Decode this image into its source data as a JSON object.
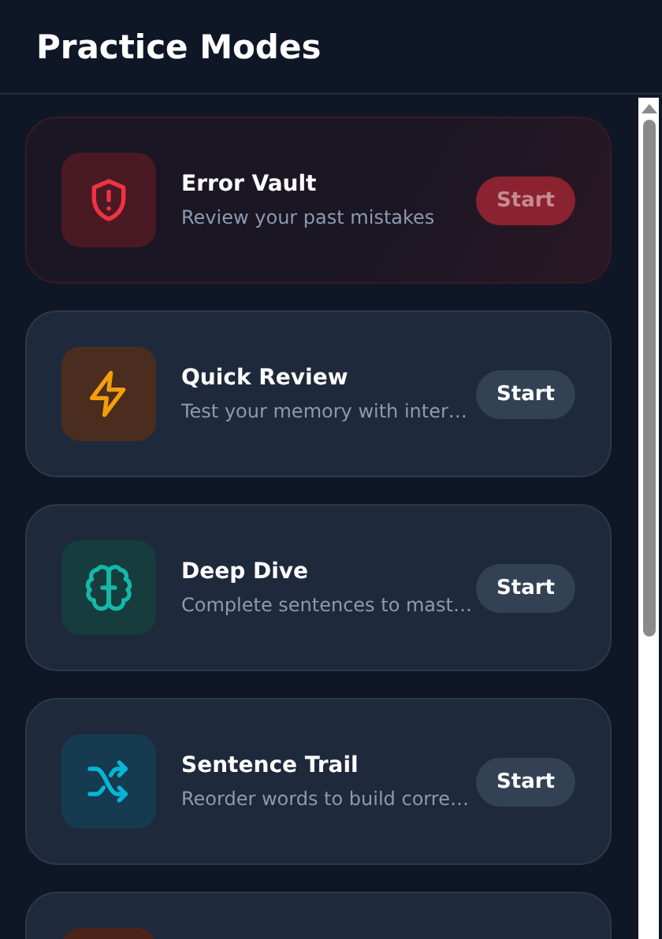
{
  "header": {
    "title": "Practice Modes"
  },
  "modes": [
    {
      "kind": "error",
      "title": "Error Vault",
      "description": "Review your past mistakes",
      "button": "Start"
    },
    {
      "kind": "lightning",
      "title": "Quick Review",
      "description": "Test your memory with inter…",
      "button": "Start"
    },
    {
      "kind": "brain",
      "title": "Deep Dive",
      "description": "Complete sentences to mast…",
      "button": "Start"
    },
    {
      "kind": "shuffle",
      "title": "Sentence Trail",
      "description": "Reorder words to build corre…",
      "button": "Start"
    },
    {
      "kind": "partial"
    }
  ]
}
